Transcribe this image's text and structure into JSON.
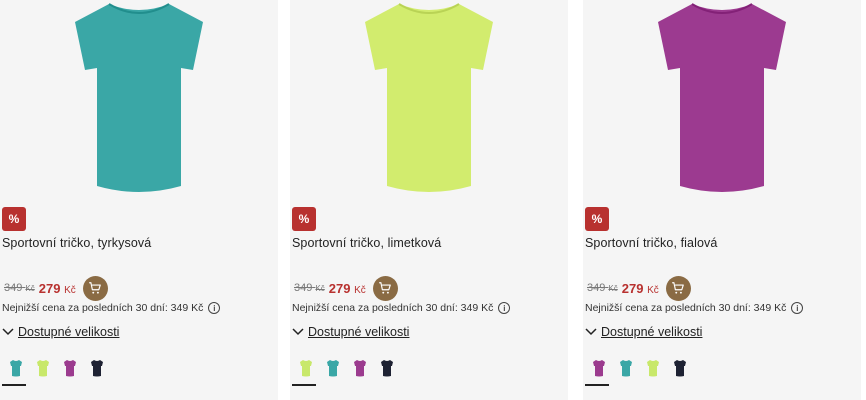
{
  "products": [
    {
      "badge": "%",
      "title": "Sportovní tričko, tyrkysová",
      "old_price": "349",
      "old_currency": "Kč",
      "new_price": "279",
      "new_currency": "Kč",
      "lowest_price_text": "Nejnižší cena za posledních 30 dní: 349 Kč",
      "sizes_label": "Dostupné velikosti",
      "color": "#3aa7a6",
      "swatches": [
        "#3aa7a6",
        "#c8e86a",
        "#9b3b8e",
        "#1e2233"
      ],
      "active_swatch": 0
    },
    {
      "badge": "%",
      "title": "Sportovní tričko, limetková",
      "old_price": "349",
      "old_currency": "Kč",
      "new_price": "279",
      "new_currency": "Kč",
      "lowest_price_text": "Nejnižší cena za posledních 30 dní: 349 Kč",
      "sizes_label": "Dostupné velikosti",
      "color": "#d2ec6e",
      "swatches": [
        "#c8e86a",
        "#3aa7a6",
        "#9b3b8e",
        "#1e2233"
      ],
      "active_swatch": 0
    },
    {
      "badge": "%",
      "title": "Sportovní tričko, fialová",
      "old_price": "349",
      "old_currency": "Kč",
      "new_price": "279",
      "new_currency": "Kč",
      "lowest_price_text": "Nejnižší cena za posledních 30 dní: 349 Kč",
      "sizes_label": "Dostupné velikosti",
      "color": "#9c3a90",
      "swatches": [
        "#9b3b8e",
        "#3aa7a6",
        "#c8e86a",
        "#1e2233"
      ],
      "active_swatch": 0
    }
  ],
  "colors": {
    "badge": "#b8312f",
    "cart_button": "#8a6b44",
    "card_bg": "#f5f5f5"
  },
  "icons": {
    "cart": "cart-icon",
    "info": "info-icon",
    "chevron": "chevron-down-icon"
  }
}
